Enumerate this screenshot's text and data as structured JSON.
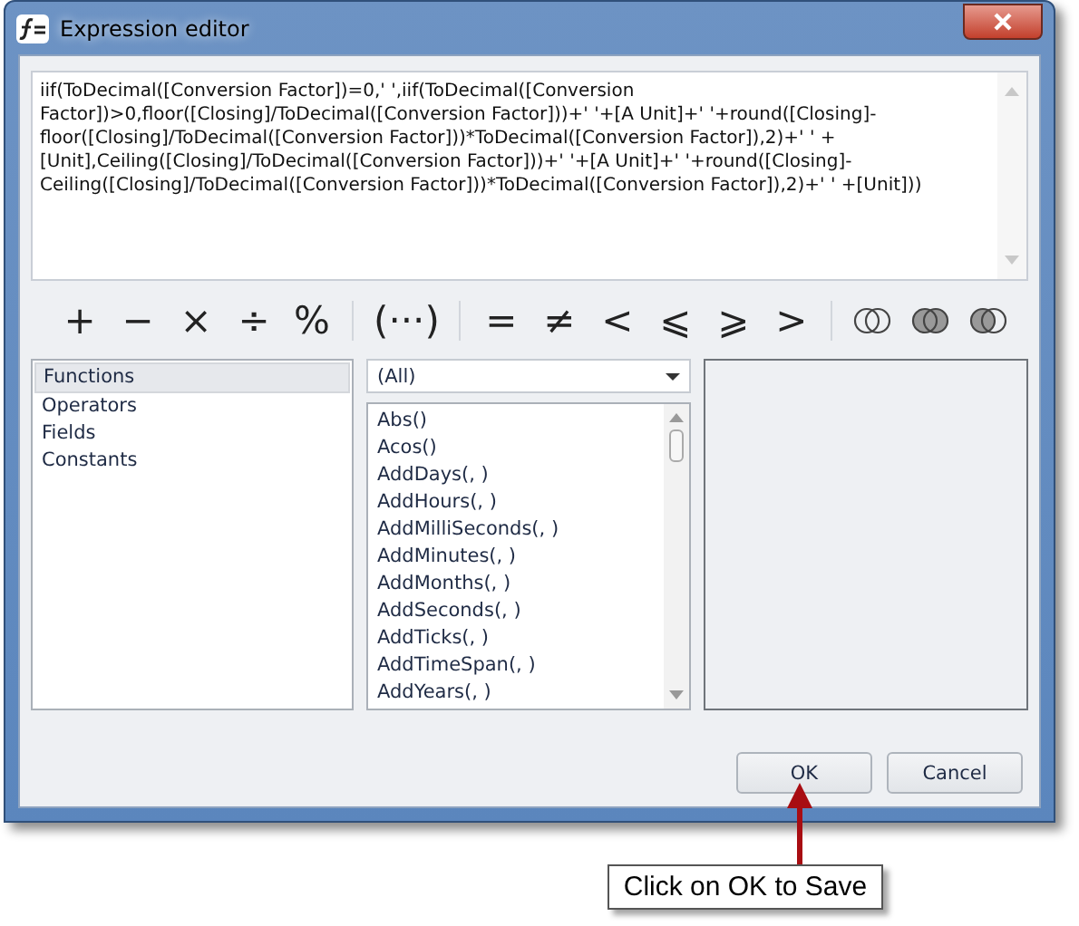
{
  "window": {
    "title": "Expression editor"
  },
  "expression": {
    "value": "iif(ToDecimal([Conversion Factor])=0,' ',iif(ToDecimal([Conversion Factor])>0,floor([Closing]/ToDecimal([Conversion Factor]))+' '+[A Unit]+' '+round([Closing]-floor([Closing]/ToDecimal([Conversion Factor]))*ToDecimal([Conversion Factor]),2)+' ' +[Unit],Ceiling([Closing]/ToDecimal([Conversion Factor]))+' '+[A Unit]+' '+round([Closing]-Ceiling([Closing]/ToDecimal([Conversion Factor]))*ToDecimal([Conversion Factor]),2)+' ' +[Unit]))"
  },
  "operator_groups": [
    {
      "items": [
        {
          "kind": "text",
          "label": "+"
        },
        {
          "kind": "text",
          "label": "−"
        },
        {
          "kind": "text",
          "label": "×"
        },
        {
          "kind": "text",
          "label": "÷"
        },
        {
          "kind": "text",
          "label": "%"
        }
      ]
    },
    {
      "items": [
        {
          "kind": "text",
          "label": "(···)"
        }
      ]
    },
    {
      "items": [
        {
          "kind": "text",
          "label": "="
        },
        {
          "kind": "text",
          "label": "≠"
        },
        {
          "kind": "text",
          "label": "<"
        },
        {
          "kind": "text",
          "label": "⩽"
        },
        {
          "kind": "text",
          "label": "⩾"
        },
        {
          "kind": "text",
          "label": ">"
        }
      ]
    },
    {
      "items": [
        {
          "kind": "venn-empty"
        },
        {
          "kind": "venn-filled"
        },
        {
          "kind": "venn-left"
        }
      ]
    }
  ],
  "categories": [
    {
      "label": "Functions",
      "selected": true
    },
    {
      "label": "Operators",
      "selected": false
    },
    {
      "label": "Fields",
      "selected": false
    },
    {
      "label": "Constants",
      "selected": false
    }
  ],
  "filter": {
    "value": "(All)"
  },
  "functions": [
    "Abs()",
    "Acos()",
    "AddDays(, )",
    "AddHours(, )",
    "AddMilliSeconds(, )",
    "AddMinutes(, )",
    "AddMonths(, )",
    "AddSeconds(, )",
    "AddTicks(, )",
    "AddTimeSpan(, )",
    "AddYears(, )"
  ],
  "buttons": [
    {
      "label": "OK"
    },
    {
      "label": "Cancel"
    }
  ],
  "callout": {
    "text": "Click on OK to Save"
  }
}
